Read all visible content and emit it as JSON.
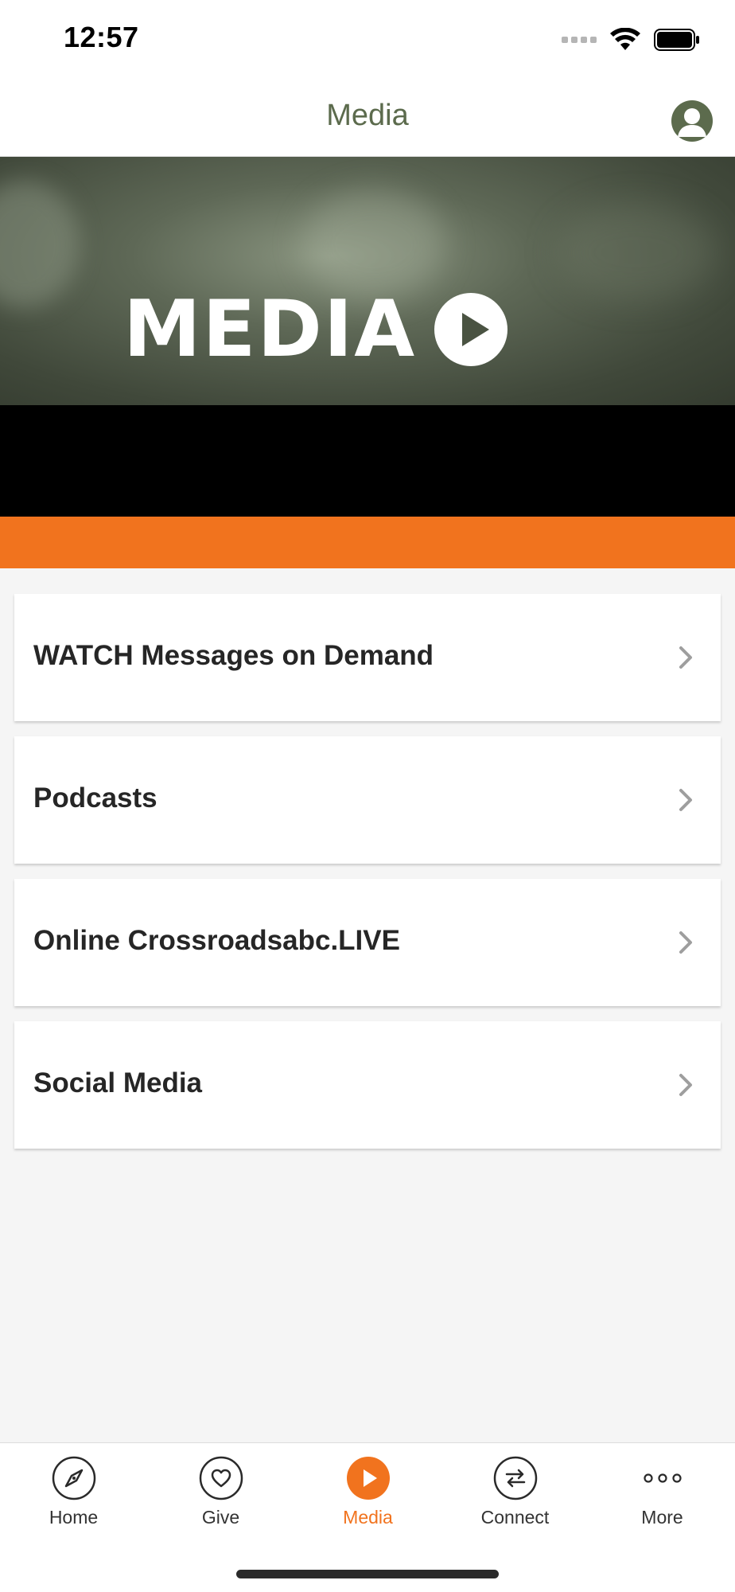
{
  "status_bar": {
    "time": "12:57"
  },
  "nav": {
    "title": "Media",
    "avatar_icon": "profile-icon",
    "title_color": "#5c6b4d"
  },
  "hero": {
    "title": "MEDIA",
    "play_icon": "play-circle-icon"
  },
  "colors": {
    "accent": "#f1731e",
    "brand_green": "#5c6b4d"
  },
  "menu": {
    "items": [
      {
        "label": "WATCH Messages on Demand",
        "icon": "chevron-right-icon"
      },
      {
        "label": "Podcasts",
        "icon": "chevron-right-icon"
      },
      {
        "label": "Online Crossroadsabc.LIVE",
        "icon": "chevron-right-icon"
      },
      {
        "label": "Social Media",
        "icon": "chevron-right-icon"
      }
    ]
  },
  "tabs": [
    {
      "label": "Home",
      "icon": "compass-icon",
      "active": false
    },
    {
      "label": "Give",
      "icon": "heart-icon",
      "active": false
    },
    {
      "label": "Media",
      "icon": "play-icon",
      "active": true
    },
    {
      "label": "Connect",
      "icon": "arrows-exchange-icon",
      "active": false
    },
    {
      "label": "More",
      "icon": "more-dots-icon",
      "active": false
    }
  ]
}
